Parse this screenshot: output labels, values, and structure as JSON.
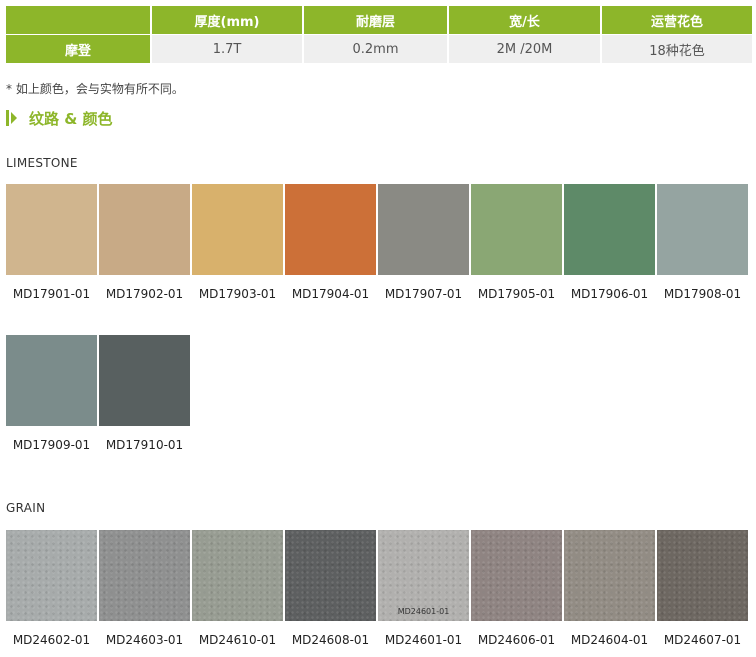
{
  "spec_table": {
    "headers": [
      "",
      "厚度(mm)",
      "耐磨层",
      "宽/长",
      "运营花色"
    ],
    "row": {
      "label": "摩登",
      "values": [
        "1.7T",
        "0.2mm",
        "2M /20M",
        "18种花色"
      ]
    },
    "colors": {
      "header_bg": "#8db62a",
      "cell_bg": "#efefef"
    }
  },
  "note": "* 如上颜色，会与实物有所不同。",
  "section_title": "纹路 & 颜色",
  "groups": {
    "limestone": {
      "label": "LIMESTONE",
      "row1": [
        {
          "code": "MD17901-01",
          "color": "#d0b58e"
        },
        {
          "code": "MD17902-01",
          "color": "#c8aa86"
        },
        {
          "code": "MD17903-01",
          "color": "#d8b16c"
        },
        {
          "code": "MD17904-01",
          "color": "#cc7038"
        },
        {
          "code": "MD17907-01",
          "color": "#8a8a84"
        },
        {
          "code": "MD17905-01",
          "color": "#8aa774"
        },
        {
          "code": "MD17906-01",
          "color": "#5e8a68"
        },
        {
          "code": "MD17908-01",
          "color": "#95a4a1"
        }
      ],
      "row2": [
        {
          "code": "MD17909-01",
          "color": "#7b8c8b"
        },
        {
          "code": "MD17910-01",
          "color": "#586060"
        }
      ]
    },
    "grain": {
      "label": "GRAIN",
      "row1": [
        {
          "code": "MD24602-01",
          "color": "#a7abab"
        },
        {
          "code": "MD24603-01",
          "color": "#8f9090"
        },
        {
          "code": "MD24610-01",
          "color": "#979c92"
        },
        {
          "code": "MD24608-01",
          "color": "#5d5f60"
        },
        {
          "code": "MD24601-01",
          "color": "#b1b0ae",
          "inner_label": "MD24601-01"
        },
        {
          "code": "MD24606-01",
          "color": "#8f8482"
        },
        {
          "code": "MD24604-01",
          "color": "#928c84"
        },
        {
          "code": "MD24607-01",
          "color": "#6d6761"
        }
      ]
    }
  }
}
